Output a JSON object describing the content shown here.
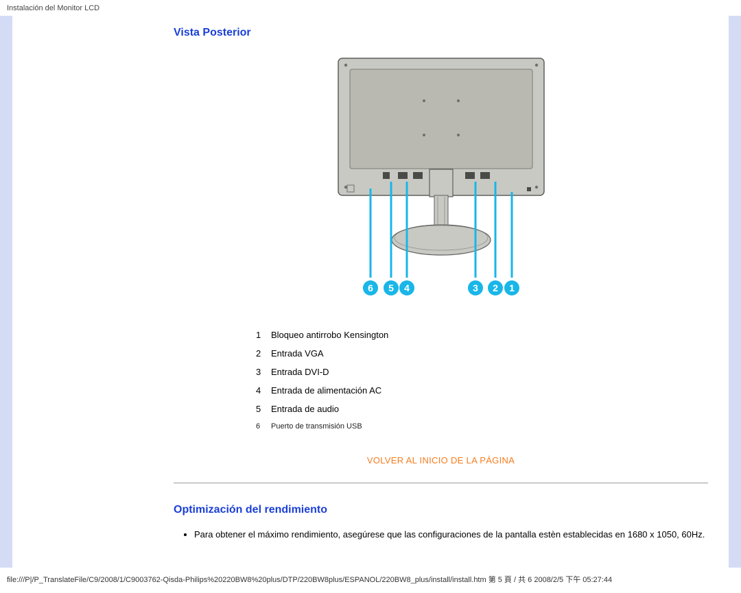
{
  "header_text": "Instalación del Monitor LCD",
  "section1_heading": "Vista Posterior",
  "diagram_callouts": [
    "6",
    "5",
    "4",
    "3",
    "2",
    "1"
  ],
  "ports": [
    {
      "n": "1",
      "label": "Bloqueo antirrobo Kensington",
      "small": false
    },
    {
      "n": "2",
      "label": "Entrada VGA",
      "small": false
    },
    {
      "n": "3",
      "label": "Entrada DVI-D",
      "small": false
    },
    {
      "n": "4",
      "label": "Entrada de alimentación AC",
      "small": false
    },
    {
      "n": "5",
      "label": "Entrada de audio",
      "small": false
    },
    {
      "n": "6",
      "label": "Puerto de transmisión USB",
      "small": true
    }
  ],
  "back_to_top": "VOLVER AL INICIO DE LA PÁGINA",
  "section2_heading": "Optimización del rendimiento",
  "tip_text": "Para obtener el máximo rendimiento, asegúrese que las configuraciones de la pantalla estèn establecidas en 1680 x 1050, 60Hz.",
  "footer_text": "file:///P|/P_TranslateFile/C9/2008/1/C9003762-Qisda-Philips%20220BW8%20plus/DTP/220BW8plus/ESPANOL/220BW8_plus/install/install.htm 第 5 頁 / 共 6  2008/2/5 下午 05:27:44"
}
